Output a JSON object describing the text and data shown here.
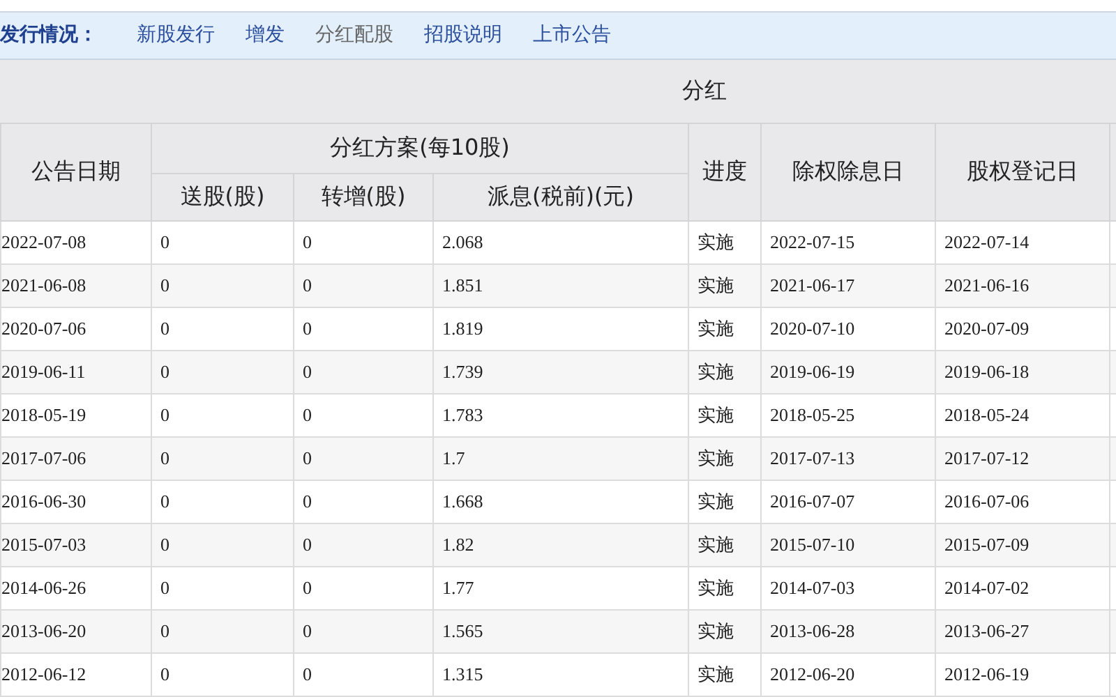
{
  "nav": {
    "label": "发行情况：",
    "links": [
      {
        "label": "新股发行",
        "selected": false
      },
      {
        "label": "增发",
        "selected": false
      },
      {
        "label": "分红配股",
        "selected": true
      },
      {
        "label": "招股说明",
        "selected": false
      },
      {
        "label": "上市公告",
        "selected": false
      }
    ]
  },
  "section_title": "分红",
  "table": {
    "columns": {
      "date": "公告日期",
      "plan": "分红方案(每10股)",
      "bonus": "送股(股)",
      "transfer": "转增(股)",
      "dividend": "派息(税前)(元)",
      "progress": "进度",
      "ex_date": "除权除息日",
      "record_date": "股权登记日"
    },
    "rows": [
      [
        "2022-07-08",
        "0",
        "0",
        "2.068",
        "实施",
        "2022-07-15",
        "2022-07-14"
      ],
      [
        "2021-06-08",
        "0",
        "0",
        "1.851",
        "实施",
        "2021-06-17",
        "2021-06-16"
      ],
      [
        "2020-07-06",
        "0",
        "0",
        "1.819",
        "实施",
        "2020-07-10",
        "2020-07-09"
      ],
      [
        "2019-06-11",
        "0",
        "0",
        "1.739",
        "实施",
        "2019-06-19",
        "2019-06-18"
      ],
      [
        "2018-05-19",
        "0",
        "0",
        "1.783",
        "实施",
        "2018-05-25",
        "2018-05-24"
      ],
      [
        "2017-07-06",
        "0",
        "0",
        "1.7",
        "实施",
        "2017-07-13",
        "2017-07-12"
      ],
      [
        "2016-06-30",
        "0",
        "0",
        "1.668",
        "实施",
        "2016-07-07",
        "2016-07-06"
      ],
      [
        "2015-07-03",
        "0",
        "0",
        "1.82",
        "实施",
        "2015-07-10",
        "2015-07-09"
      ],
      [
        "2014-06-26",
        "0",
        "0",
        "1.77",
        "实施",
        "2014-07-03",
        "2014-07-02"
      ],
      [
        "2013-06-20",
        "0",
        "0",
        "1.565",
        "实施",
        "2013-06-28",
        "2013-06-27"
      ],
      [
        "2012-06-12",
        "0",
        "0",
        "1.315",
        "实施",
        "2012-06-20",
        "2012-06-19"
      ]
    ]
  }
}
